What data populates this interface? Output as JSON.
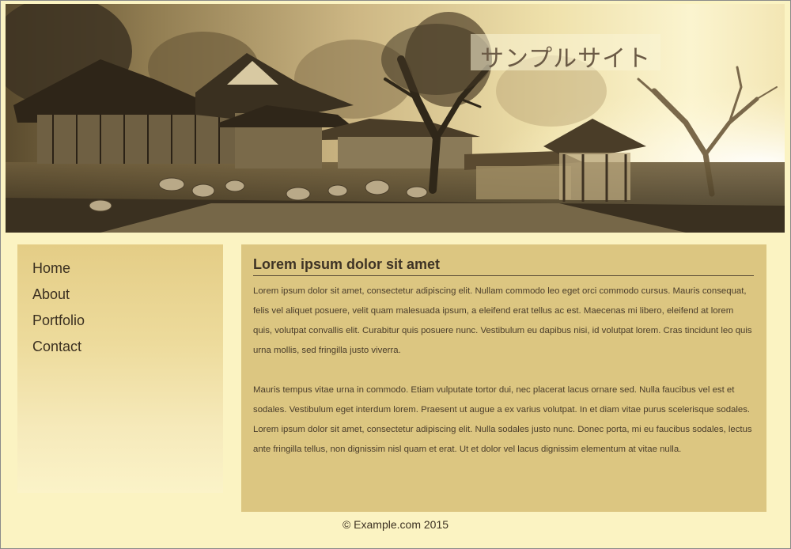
{
  "header": {
    "site_title": "サンプルサイト"
  },
  "nav": {
    "items": [
      {
        "label": "Home"
      },
      {
        "label": "About"
      },
      {
        "label": "Portfolio"
      },
      {
        "label": "Contact"
      }
    ]
  },
  "article": {
    "heading": "Lorem ipsum dolor sit amet",
    "paragraphs": [
      "Lorem ipsum dolor sit amet, consectetur adipiscing elit. Nullam commodo leo eget orci commodo cursus. Mauris consequat, felis vel aliquet posuere, velit quam malesuada ipsum, a eleifend erat tellus ac est. Maecenas mi libero, eleifend at lorem quis, volutpat convallis elit. Curabitur quis posuere nunc. Vestibulum eu dapibus nisi, id volutpat lorem. Cras tincidunt leo quis urna mollis, sed fringilla justo viverra.",
      "Mauris tempus vitae urna in commodo. Etiam vulputate tortor dui, nec placerat lacus ornare sed. Nulla faucibus vel est et sodales. Vestibulum eget interdum lorem. Praesent ut augue a ex varius volutpat. In et diam vitae purus scelerisque sodales. Lorem ipsum dolor sit amet, consectetur adipiscing elit. Nulla sodales justo nunc. Donec porta, mi eu faucibus sodales, lectus ante fringilla tellus, non dignissim nisl quam et erat. Ut et dolor vel lacus dignissim elementum at vitae nulla."
    ]
  },
  "footer": {
    "copyright": "© Example.com 2015"
  },
  "colors": {
    "page_background": "#fbf3c2",
    "content_background": "#dcc681",
    "text": "#3b3021"
  }
}
